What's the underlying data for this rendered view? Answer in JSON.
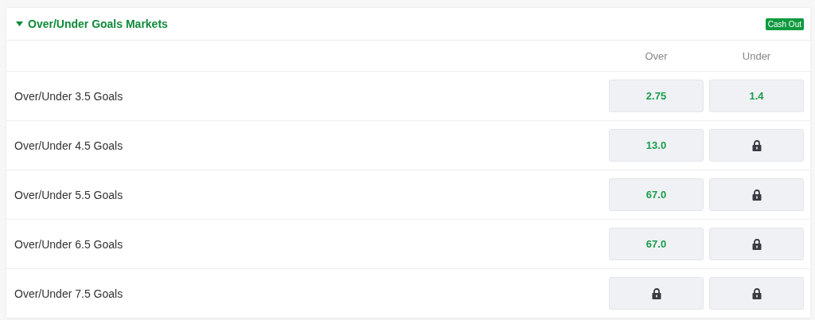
{
  "section": {
    "title": "Over/Under Goals Markets",
    "expanded": true,
    "badge": "Cash Out"
  },
  "columns": [
    "Over",
    "Under"
  ],
  "rows": [
    {
      "name": "Over/Under 3.5 Goals",
      "odds": [
        {
          "locked": false,
          "value": "2.75"
        },
        {
          "locked": false,
          "value": "1.4"
        }
      ]
    },
    {
      "name": "Over/Under 4.5 Goals",
      "odds": [
        {
          "locked": false,
          "value": "13.0"
        },
        {
          "locked": true
        }
      ]
    },
    {
      "name": "Over/Under 5.5 Goals",
      "odds": [
        {
          "locked": false,
          "value": "67.0"
        },
        {
          "locked": true
        }
      ]
    },
    {
      "name": "Over/Under 6.5 Goals",
      "odds": [
        {
          "locked": false,
          "value": "67.0"
        },
        {
          "locked": true
        }
      ]
    },
    {
      "name": "Over/Under 7.5 Goals",
      "odds": [
        {
          "locked": true
        },
        {
          "locked": true
        }
      ]
    }
  ]
}
